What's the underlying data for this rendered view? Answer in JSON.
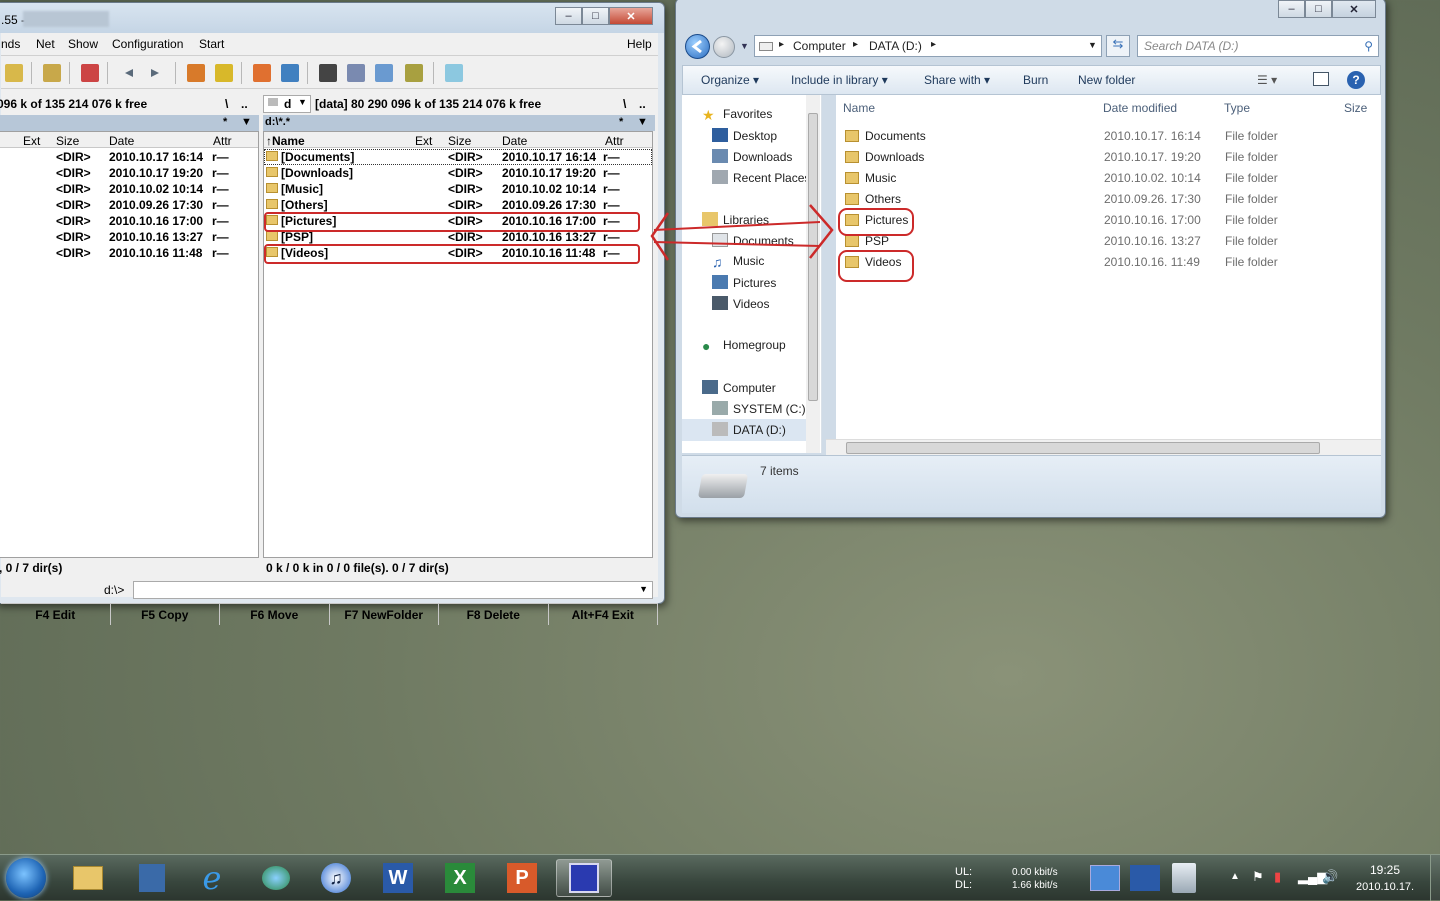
{
  "colors": {
    "annotation": "#cc2a2a",
    "selection": "#b7c7d8",
    "link": "#1e395b"
  },
  "tc": {
    "title": ".55 -",
    "menu": [
      "nds",
      "Net",
      "Show",
      "Configuration",
      "Start",
      "Help"
    ],
    "left": {
      "freespace": "096 k of  135 214 076 k free",
      "root": "\\",
      "up": "..",
      "filter": "*",
      "columns": [
        "Ext",
        "Size",
        "Date",
        "Attr"
      ],
      "rows": [
        {
          "size": "<DIR>",
          "date": "2010.10.17 16:14",
          "attr": "r—"
        },
        {
          "size": "<DIR>",
          "date": "2010.10.17 19:20",
          "attr": "r—"
        },
        {
          "size": "<DIR>",
          "date": "2010.10.02 10:14",
          "attr": "r—"
        },
        {
          "size": "<DIR>",
          "date": "2010.09.26 17:30",
          "attr": "r—"
        },
        {
          "size": "<DIR>",
          "date": "2010.10.16 17:00",
          "attr": "r—"
        },
        {
          "size": "<DIR>",
          "date": "2010.10.16 13:27",
          "attr": "r—"
        },
        {
          "size": "<DIR>",
          "date": "2010.10.16 11:48",
          "attr": "r—"
        }
      ],
      "status": "), 0 / 7 dir(s)"
    },
    "right": {
      "drive": "d",
      "freespace": "[data]  80 290 096 k of  135 214 076 k free",
      "root": "\\",
      "up": "..",
      "path": "d:\\*.*",
      "filter": "*",
      "columns": [
        "Name",
        "Ext",
        "Size",
        "Date",
        "Attr"
      ],
      "rows": [
        {
          "name": "[Documents]",
          "size": "<DIR>",
          "date": "2010.10.17 16:14",
          "attr": "r—"
        },
        {
          "name": "[Downloads]",
          "size": "<DIR>",
          "date": "2010.10.17 19:20",
          "attr": "r—"
        },
        {
          "name": "[Music]",
          "size": "<DIR>",
          "date": "2010.10.02 10:14",
          "attr": "r—"
        },
        {
          "name": "[Others]",
          "size": "<DIR>",
          "date": "2010.09.26 17:30",
          "attr": "r—"
        },
        {
          "name": "[Pictures]",
          "size": "<DIR>",
          "date": "2010.10.16 17:00",
          "attr": "r—"
        },
        {
          "name": "[PSP]",
          "size": "<DIR>",
          "date": "2010.10.16 13:27",
          "attr": "r—"
        },
        {
          "name": "[Videos]",
          "size": "<DIR>",
          "date": "2010.10.16 11:48",
          "attr": "r—"
        }
      ],
      "status": "0 k / 0 k in 0 / 0 file(s). 0 / 7 dir(s)"
    },
    "cmd_prompt": "d:\\>",
    "fkeys": [
      "F4 Edit",
      "F5 Copy",
      "F6 Move",
      "F7 NewFolder",
      "F8 Delete",
      "Alt+F4 Exit"
    ]
  },
  "explorer": {
    "breadcrumb": [
      "Computer",
      "DATA (D:)"
    ],
    "search_placeholder": "Search DATA (D:)",
    "commands": [
      "Organize",
      "Include in library",
      "Share with",
      "Burn",
      "New folder"
    ],
    "nav": {
      "favorites": "Favorites",
      "fav_items": [
        "Desktop",
        "Downloads",
        "Recent Places"
      ],
      "libraries": "Libraries",
      "lib_items": [
        "Documents",
        "Music",
        "Pictures",
        "Videos"
      ],
      "homegroup": "Homegroup",
      "computer": "Computer",
      "drives": [
        "SYSTEM (C:)",
        "DATA (D:)"
      ]
    },
    "columns": [
      "Name",
      "Date modified",
      "Type",
      "Size"
    ],
    "files": [
      {
        "name": "Documents",
        "date": "2010.10.17. 16:14",
        "type": "File folder"
      },
      {
        "name": "Downloads",
        "date": "2010.10.17. 19:20",
        "type": "File folder"
      },
      {
        "name": "Music",
        "date": "2010.10.02. 10:14",
        "type": "File folder"
      },
      {
        "name": "Others",
        "date": "2010.09.26. 17:30",
        "type": "File folder"
      },
      {
        "name": "Pictures",
        "date": "2010.10.16. 17:00",
        "type": "File folder"
      },
      {
        "name": "PSP",
        "date": "2010.10.16. 13:27",
        "type": "File folder"
      },
      {
        "name": "Videos",
        "date": "2010.10.16. 11:49",
        "type": "File folder"
      }
    ],
    "item_count": "7 items"
  },
  "taskbar": {
    "ul_label": "UL:",
    "dl_label": "DL:",
    "ul_rate": "0.00 kbit/s",
    "dl_rate": "1.66 kbit/s",
    "time": "19:25",
    "date": "2010.10.17."
  }
}
